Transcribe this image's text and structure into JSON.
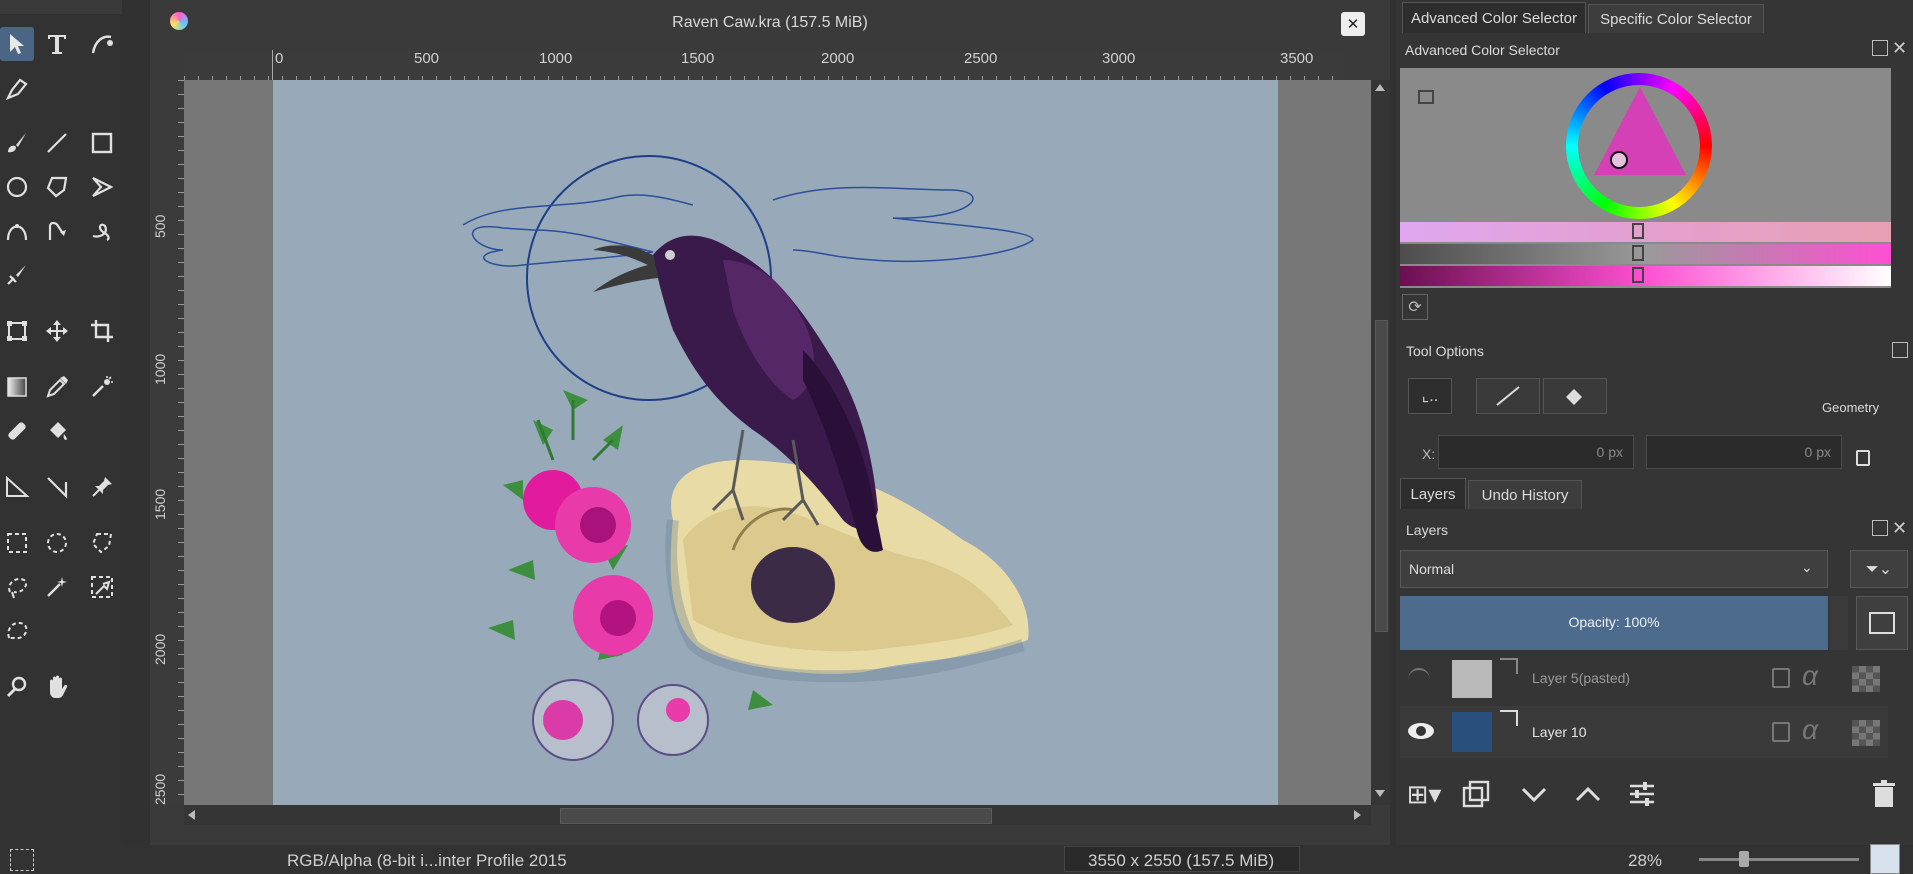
{
  "document": {
    "title": "Raven Caw.kra (157.5 MiB)",
    "close_glyph": "✕"
  },
  "ruler": {
    "top_ticks": [
      "0",
      "500",
      "1000",
      "1500",
      "2000",
      "2500",
      "3000",
      "3500"
    ],
    "left_ticks": [
      "500",
      "1000",
      "1500",
      "2000",
      "2500"
    ]
  },
  "toolbox": {
    "tools": [
      "select-shapes",
      "text",
      "calligraphy",
      "pen",
      "brush",
      "line",
      "rectangle",
      "ellipse",
      "polygon",
      "polyline",
      "bezier",
      "freehand-path",
      "dynamic-brush",
      "multibrush",
      "transform",
      "move",
      "crop",
      "gradient",
      "color-picker",
      "smart-patch",
      "fill",
      "pattern-fill",
      "assistant",
      "measure",
      "reference",
      "rect-select",
      "ellipse-select",
      "polygon-select",
      "freehand-select",
      "magic-wand",
      "similar-select",
      "bezier-select",
      "zoom",
      "pan"
    ]
  },
  "color_selector": {
    "tab_advanced": "Advanced Color Selector",
    "tab_specific": "Specific Color Selector",
    "title": "Advanced Color Selector",
    "accent": "#ff4fd3"
  },
  "tool_options": {
    "title": "Tool Options",
    "geometry_label": "Geometry",
    "x_label": "X:",
    "x_value": "0 px",
    "y_value": "0 px"
  },
  "layers": {
    "tab_layers": "Layers",
    "tab_undo": "Undo History",
    "title": "Layers",
    "blend_mode": "Normal",
    "opacity_text": "Opacity:  100%",
    "items": [
      {
        "name": "Layer 5(pasted)",
        "visible": false
      },
      {
        "name": "Layer 10",
        "visible": true
      }
    ]
  },
  "status": {
    "color_profile": "RGB/Alpha (8-bit i...inter Profile 2015",
    "dimensions": "3550 x 2550 (157.5 MiB)",
    "zoom": "28%"
  }
}
